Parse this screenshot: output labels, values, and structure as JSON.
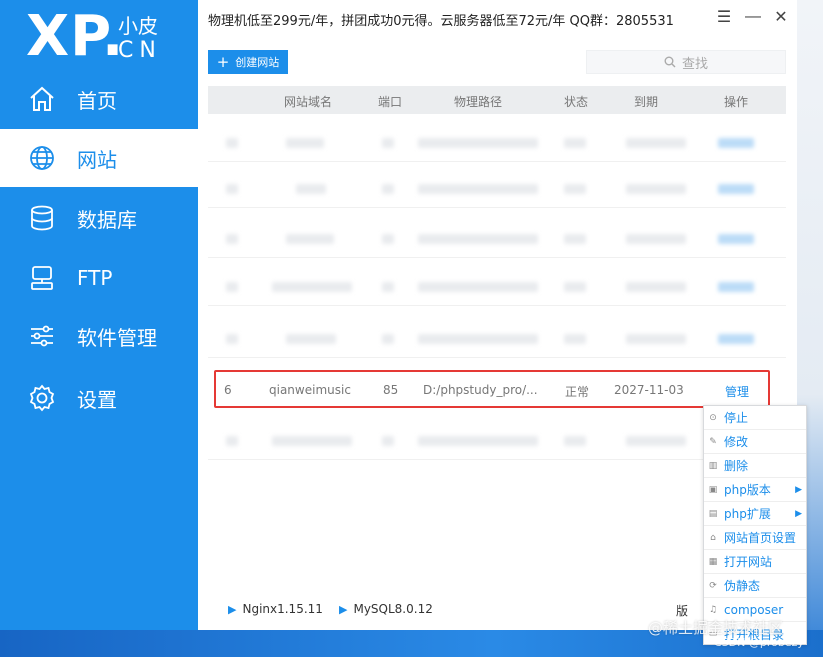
{
  "banner": {
    "text": "物理机低至299元/年，拼团成功0元得。云服务器低至72元/年  QQ群：2805531"
  },
  "logo": {
    "brand": "XP.",
    "cn_top": "小皮",
    "cn_bottom": "CN"
  },
  "sidebar": {
    "items": [
      {
        "label": "首页",
        "icon": "home-icon",
        "active": false
      },
      {
        "label": "网站",
        "icon": "globe-icon",
        "active": true
      },
      {
        "label": "数据库",
        "icon": "database-icon",
        "active": false
      },
      {
        "label": "FTP",
        "icon": "server-icon",
        "active": false
      },
      {
        "label": "软件管理",
        "icon": "sliders-icon",
        "active": false
      },
      {
        "label": "设置",
        "icon": "gear-icon",
        "active": false
      }
    ]
  },
  "toolbar": {
    "create_label": "创建网站",
    "search_placeholder": "查找"
  },
  "table": {
    "headers": [
      "网站域名",
      "端口",
      "物理路径",
      "状态",
      "到期",
      "操作"
    ],
    "highlighted_row": {
      "id": "6",
      "domain": "qianweimusic",
      "port": "85",
      "path": "D:/phpstudy_pro/...",
      "status": "正常",
      "expire": "2027-11-03",
      "action": "管理"
    }
  },
  "context_menu": {
    "items": [
      {
        "label": "停止",
        "icon": "stop-icon",
        "submenu": false
      },
      {
        "label": "修改",
        "icon": "edit-icon",
        "submenu": false
      },
      {
        "label": "删除",
        "icon": "trash-icon",
        "submenu": false
      },
      {
        "label": "php版本",
        "icon": "php-icon",
        "submenu": true
      },
      {
        "label": "php扩展",
        "icon": "extension-icon",
        "submenu": true
      },
      {
        "label": "网站首页设置",
        "icon": "home-small-icon",
        "submenu": false
      },
      {
        "label": "打开网站",
        "icon": "open-icon",
        "submenu": false
      },
      {
        "label": "伪静态",
        "icon": "rewrite-icon",
        "submenu": false
      },
      {
        "label": "composer",
        "icon": "composer-icon",
        "submenu": false
      },
      {
        "label": "打开根目录",
        "icon": "folder-icon",
        "submenu": false
      }
    ]
  },
  "statusbar": {
    "nginx": "Nginx1.15.11",
    "mysql": "MySQL8.0.12",
    "version_partial": "版"
  },
  "watermark": {
    "line1": "@稀土掘金技术社区",
    "line2": "CSDN @probezy"
  },
  "colors": {
    "accent": "#1c8eea",
    "highlight_border": "#e53935"
  }
}
